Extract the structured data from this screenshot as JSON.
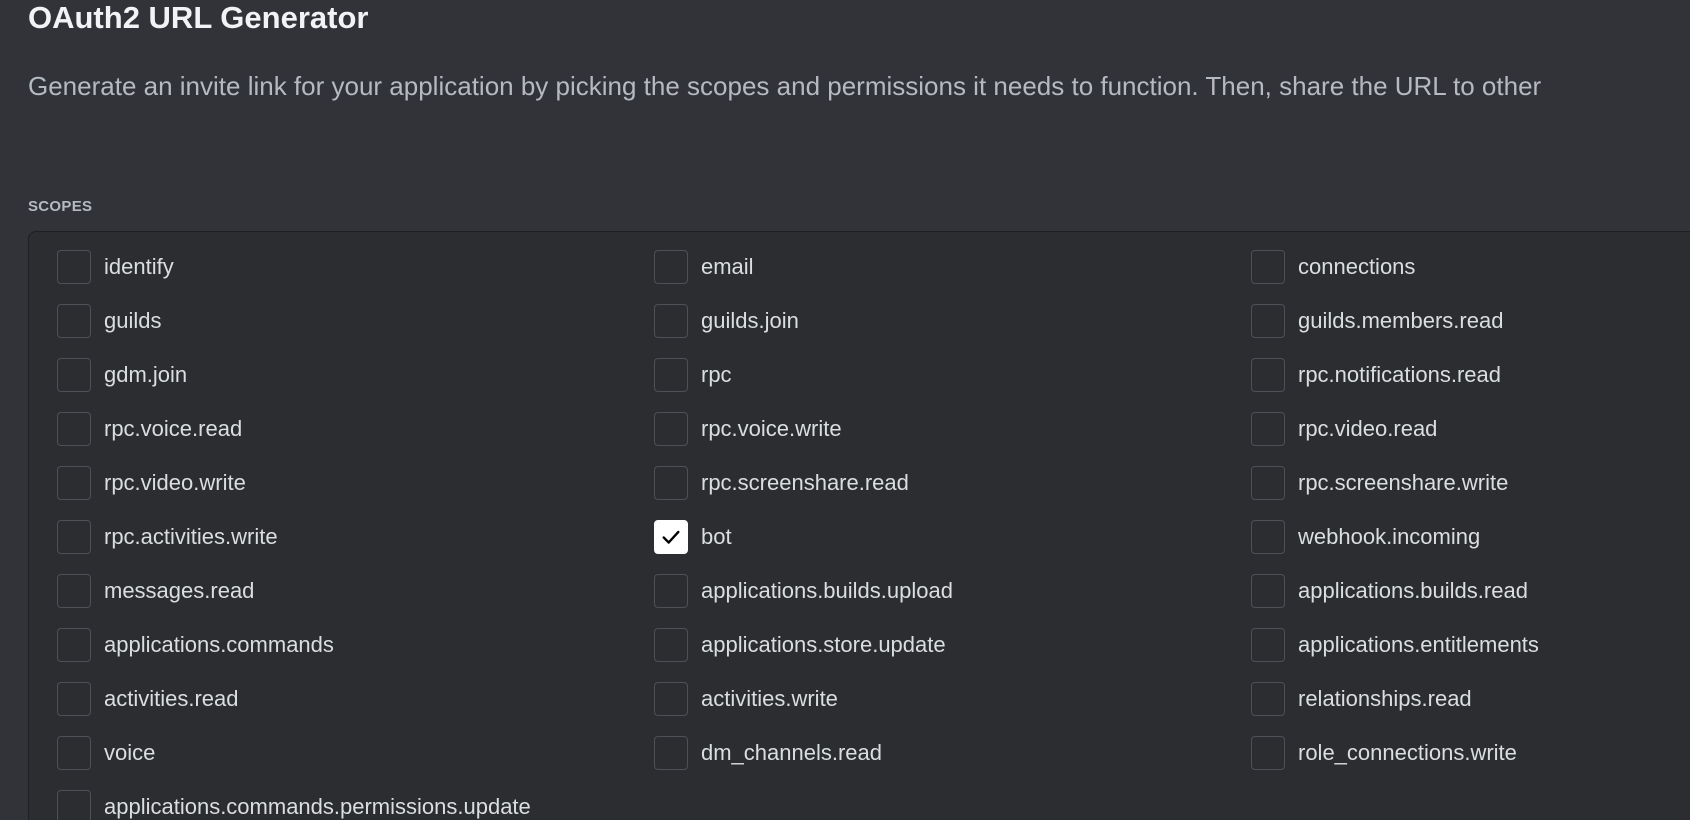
{
  "header": {
    "title": "OAuth2 URL Generator",
    "description": "Generate an invite link for your application by picking the scopes and permissions it needs to function. Then, share the URL to other"
  },
  "scopes": {
    "label": "SCOPES",
    "items": [
      {
        "label": "identify",
        "checked": false
      },
      {
        "label": "email",
        "checked": false
      },
      {
        "label": "connections",
        "checked": false
      },
      {
        "label": "guilds",
        "checked": false
      },
      {
        "label": "guilds.join",
        "checked": false
      },
      {
        "label": "guilds.members.read",
        "checked": false
      },
      {
        "label": "gdm.join",
        "checked": false
      },
      {
        "label": "rpc",
        "checked": false
      },
      {
        "label": "rpc.notifications.read",
        "checked": false
      },
      {
        "label": "rpc.voice.read",
        "checked": false
      },
      {
        "label": "rpc.voice.write",
        "checked": false
      },
      {
        "label": "rpc.video.read",
        "checked": false
      },
      {
        "label": "rpc.video.write",
        "checked": false
      },
      {
        "label": "rpc.screenshare.read",
        "checked": false
      },
      {
        "label": "rpc.screenshare.write",
        "checked": false
      },
      {
        "label": "rpc.activities.write",
        "checked": false
      },
      {
        "label": "bot",
        "checked": true
      },
      {
        "label": "webhook.incoming",
        "checked": false
      },
      {
        "label": "messages.read",
        "checked": false
      },
      {
        "label": "applications.builds.upload",
        "checked": false
      },
      {
        "label": "applications.builds.read",
        "checked": false
      },
      {
        "label": "applications.commands",
        "checked": false
      },
      {
        "label": "applications.store.update",
        "checked": false
      },
      {
        "label": "applications.entitlements",
        "checked": false
      },
      {
        "label": "activities.read",
        "checked": false
      },
      {
        "label": "activities.write",
        "checked": false
      },
      {
        "label": "relationships.read",
        "checked": false
      },
      {
        "label": "voice",
        "checked": false
      },
      {
        "label": "dm_channels.read",
        "checked": false
      },
      {
        "label": "role_connections.write",
        "checked": false
      },
      {
        "label": "applications.commands.permissions.update",
        "checked": false
      }
    ]
  },
  "colors": {
    "background": "#313338",
    "panel": "#2b2d31",
    "checked_fill": "#ffffff"
  }
}
